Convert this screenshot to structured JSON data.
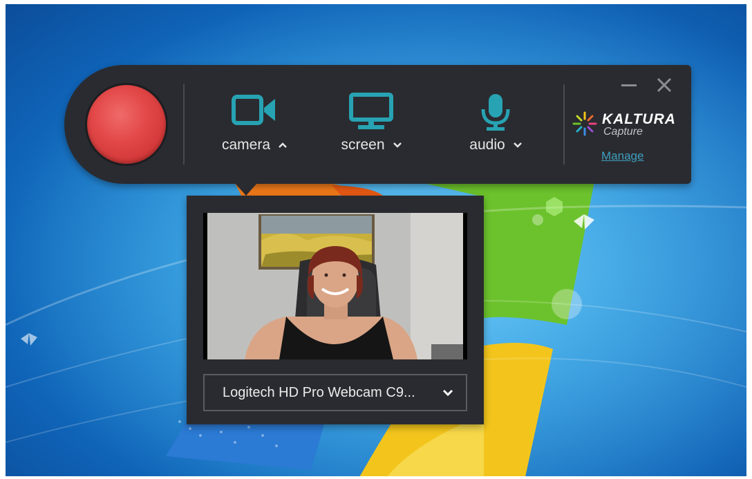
{
  "recorder": {
    "tools": [
      {
        "name": "camera",
        "label": "camera",
        "chevron": "up"
      },
      {
        "name": "screen",
        "label": "screen",
        "chevron": "down"
      },
      {
        "name": "audio",
        "label": "audio",
        "chevron": "down"
      }
    ],
    "brand": {
      "name": "KALTURA",
      "sub": "Capture"
    },
    "manage_label": "Manage",
    "colors": {
      "accent": "#27a3b3",
      "record": "#e04343",
      "panel": "#2a2b30",
      "link": "#3d9fbe"
    }
  },
  "camera_popup": {
    "selected_device": "Logitech HD Pro Webcam C9..."
  }
}
